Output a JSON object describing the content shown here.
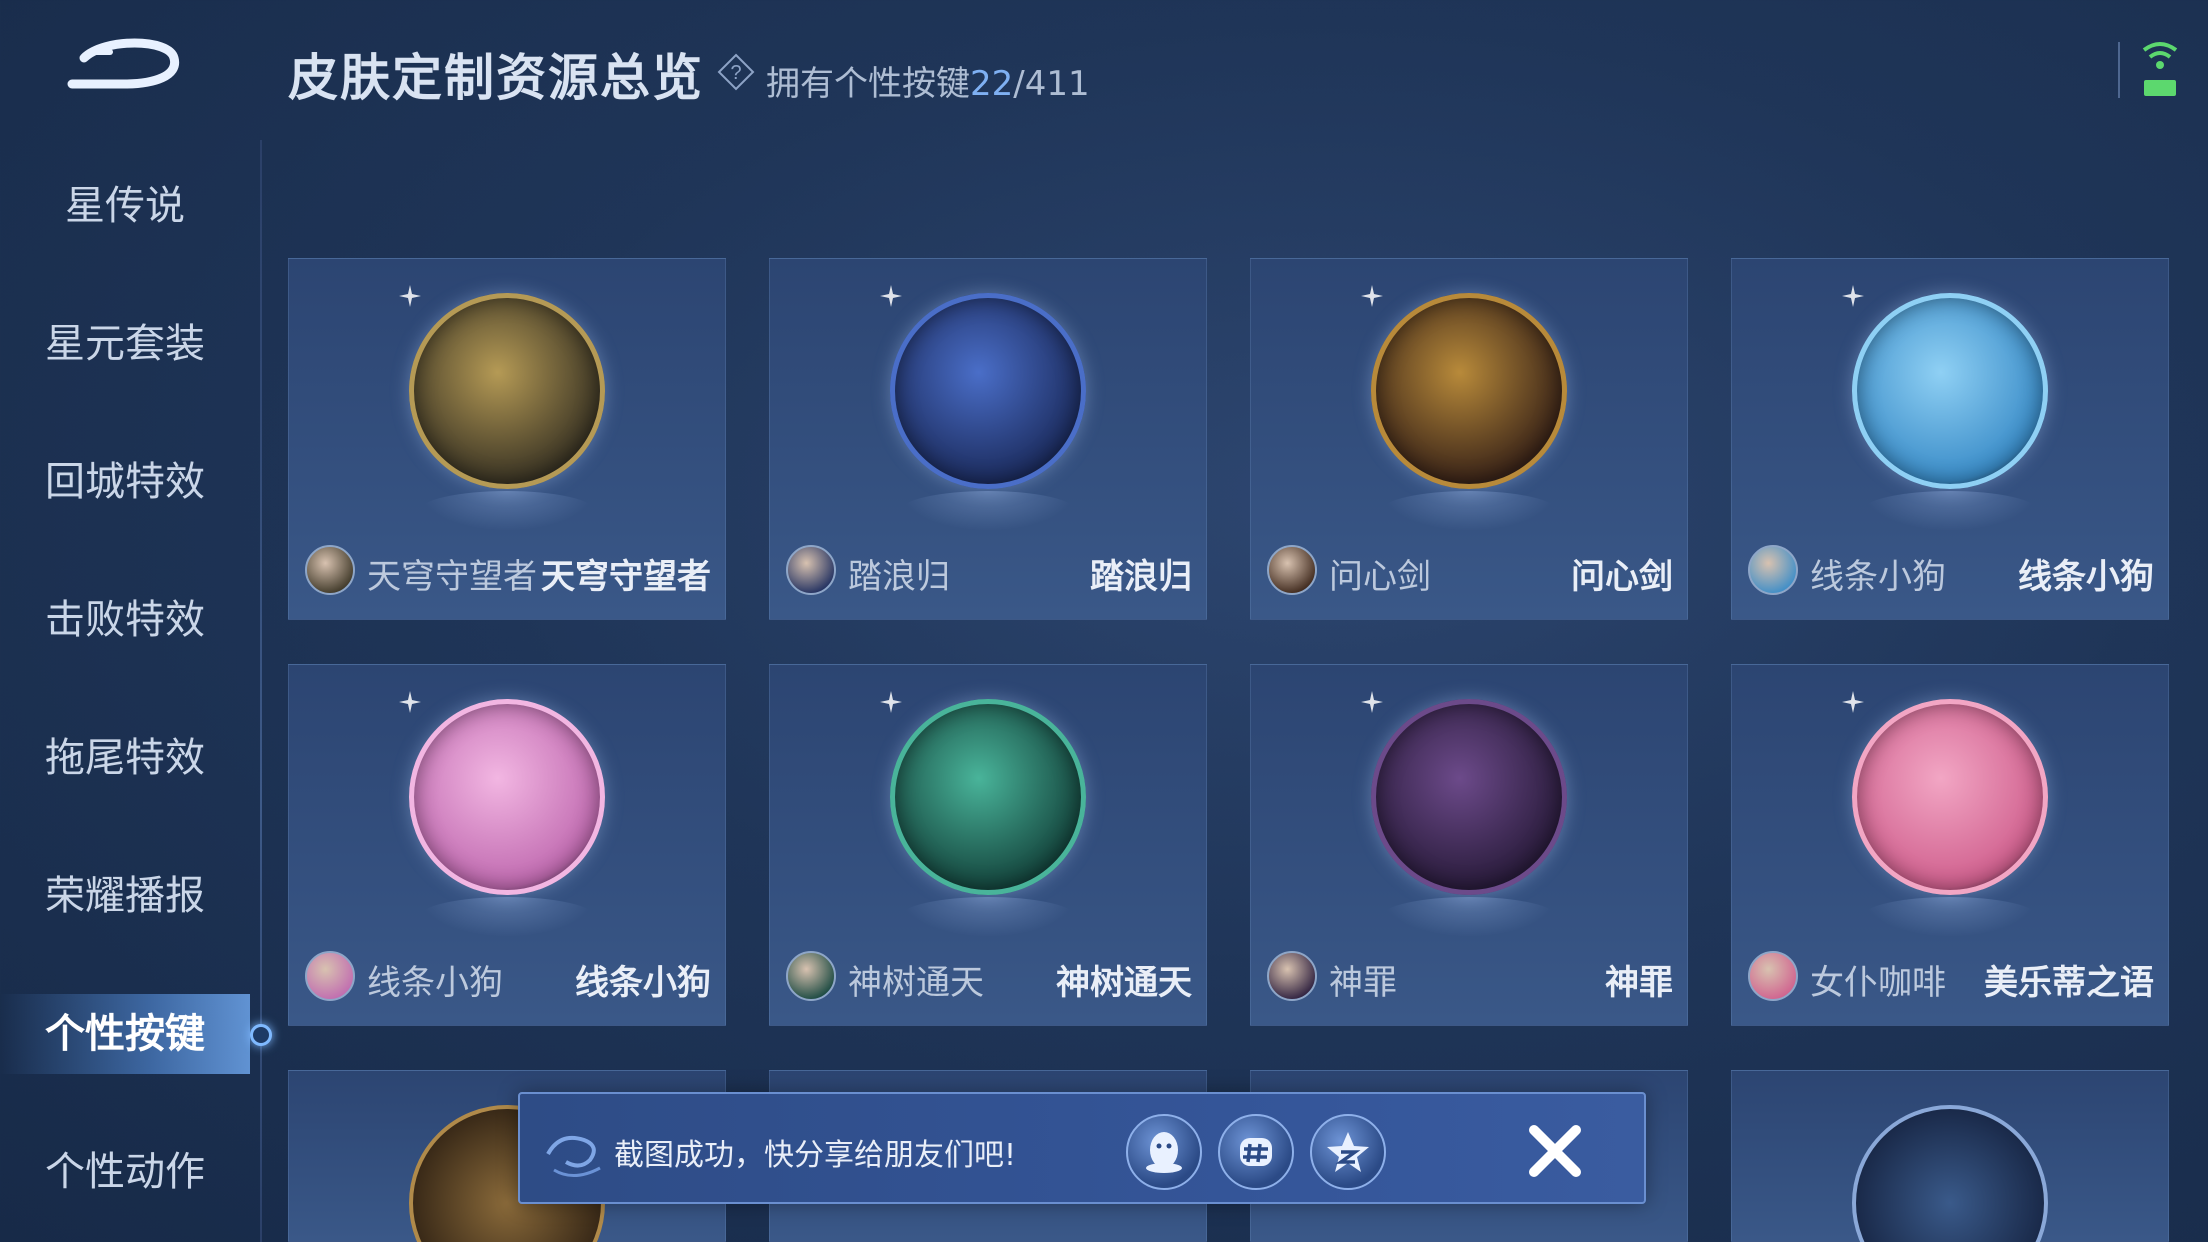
{
  "header": {
    "title": "皮肤定制资源总览",
    "owned_label": "拥有个性按键",
    "owned_count": "22",
    "owned_total": "/411"
  },
  "sidebar": {
    "items": [
      {
        "label": "星传说"
      },
      {
        "label": "星元套装"
      },
      {
        "label": "回城特效"
      },
      {
        "label": "击败特效"
      },
      {
        "label": "拖尾特效"
      },
      {
        "label": "荣耀播报"
      },
      {
        "label": "个性按键",
        "active": true
      },
      {
        "label": "个性动作"
      }
    ]
  },
  "cards": [
    {
      "hero": "天穹守望者",
      "skin": "天穹守望者",
      "badge_color": "#b59a55",
      "badge_dark": "#3a3424",
      "icon": "bow-icon"
    },
    {
      "hero": "踏浪归",
      "skin": "踏浪归",
      "badge_color": "#4a6ec8",
      "badge_dark": "#1c2c5e",
      "icon": "trident-icon"
    },
    {
      "hero": "问心剑",
      "skin": "问心剑",
      "badge_color": "#b88a3a",
      "badge_dark": "#3a2418",
      "icon": "sword-icon"
    },
    {
      "hero": "线条小狗",
      "skin": "线条小狗",
      "badge_color": "#8fd0f4",
      "badge_dark": "#3a8cc8",
      "icon": "line-puppy-icon"
    },
    {
      "hero": "线条小狗",
      "skin": "线条小狗",
      "badge_color": "#f2b6e2",
      "badge_dark": "#c06ab0",
      "icon": "sleeping-puppy-icon"
    },
    {
      "hero": "神树通天",
      "skin": "神树通天",
      "badge_color": "#49b49a",
      "badge_dark": "#15463e",
      "icon": "divine-tree-icon"
    },
    {
      "hero": "神罪",
      "skin": "神罪",
      "badge_color": "#6c4a8a",
      "badge_dark": "#2a1c3c",
      "icon": "spear-icon"
    },
    {
      "hero": "女仆咖啡",
      "skin": "美乐蒂之语",
      "badge_color": "#f2a6c4",
      "badge_dark": "#d0608e",
      "icon": "my-melody-icon"
    }
  ],
  "toast": {
    "message": "截图成功，快分享给朋友们吧!",
    "buttons": [
      "qq-icon",
      "wechat-moments-icon",
      "qzone-icon",
      "close-icon"
    ]
  },
  "colors": {
    "accent": "#7fb0f2",
    "background": "#1f3558",
    "card": "#34507f"
  }
}
